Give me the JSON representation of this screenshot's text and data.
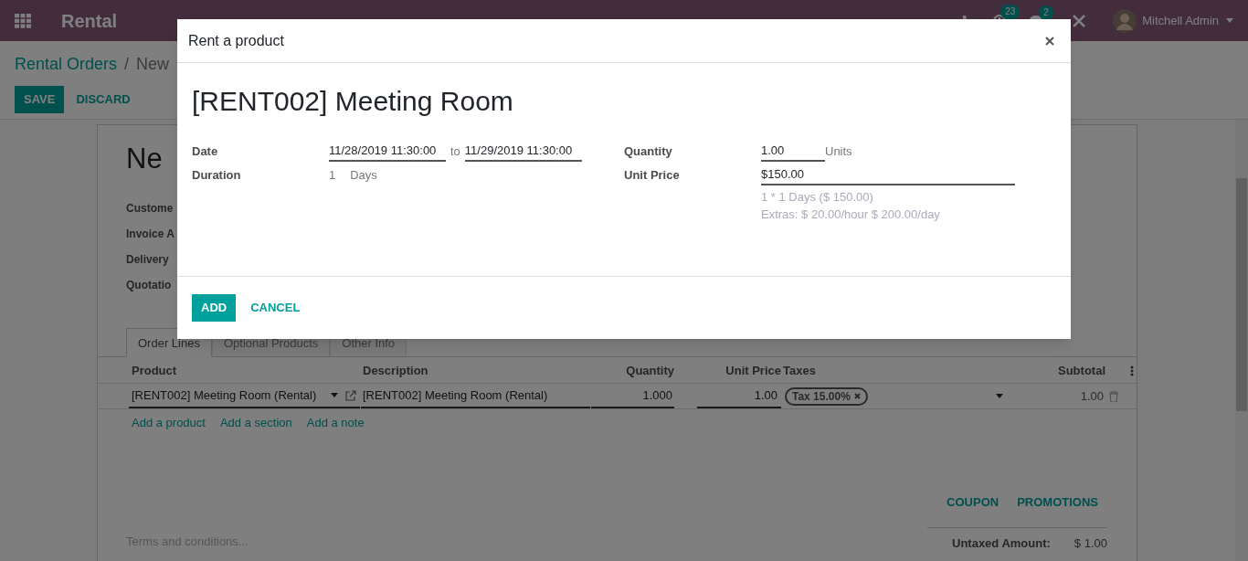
{
  "navbar": {
    "app_name": "Rental",
    "activity_count": "23",
    "message_count": "2",
    "user": "Mitchell Admin"
  },
  "breadcrumb": [
    {
      "label": "Rental Orders",
      "kind": "link"
    },
    {
      "label": "New",
      "kind": "current"
    }
  ],
  "breadcrumb_separator": "/",
  "actions": [
    {
      "label": "SAVE",
      "kind": "primary"
    },
    {
      "label": "DISCARD",
      "kind": "link"
    }
  ],
  "form": {
    "title": "Ne",
    "labels": [
      "Custome",
      "Invoice A",
      "Delivery",
      "Quotatio"
    ]
  },
  "tabs": [
    {
      "label": "Order Lines",
      "selected": true
    },
    {
      "label": "Optional Products",
      "selected": false
    },
    {
      "label": "Other Info",
      "selected": false
    }
  ],
  "order_lines": {
    "columns": [
      "Product",
      "Description",
      "Quantity",
      "Unit Price",
      "Taxes",
      "Subtotal"
    ],
    "rows": [
      {
        "product": "[RENT002] Meeting Room (Rental)",
        "description": "[RENT002] Meeting Room (Rental)",
        "quantity": "1.000",
        "unit_price": "1.00",
        "taxes": [
          "Tax 15.00%"
        ],
        "subtotal": "1.00"
      }
    ],
    "add_links": [
      "Add a product",
      "Add a section",
      "Add a note"
    ]
  },
  "promo_buttons": [
    "COUPON",
    "PROMOTIONS"
  ],
  "terms": {
    "placeholder": "Terms and conditions..."
  },
  "totals": [
    {
      "label": "Untaxed Amount:",
      "value": "$ 1.00"
    }
  ],
  "dialog": {
    "title": "Rent a product",
    "product": "[RENT002] Meeting Room",
    "date_label": "Date",
    "start": "11/28/2019 11:30:00",
    "separator": "to",
    "end": "11/29/2019 11:30:00",
    "duration_label": "Duration",
    "duration": "1",
    "duration_unit": "Days",
    "quantity_label": "Quantity",
    "quantity": "1.00",
    "quantity_unit": "Units",
    "unit_price_label": "Unit Price",
    "unit_price": "$150.00",
    "price_notes": [
      "1 * 1 Days ($ 150.00)",
      "Extras: $ 20.00/hour $ 200.00/day"
    ],
    "buttons": [
      {
        "label": "ADD",
        "kind": "primary"
      },
      {
        "label": "CANCEL",
        "kind": "link"
      }
    ]
  }
}
